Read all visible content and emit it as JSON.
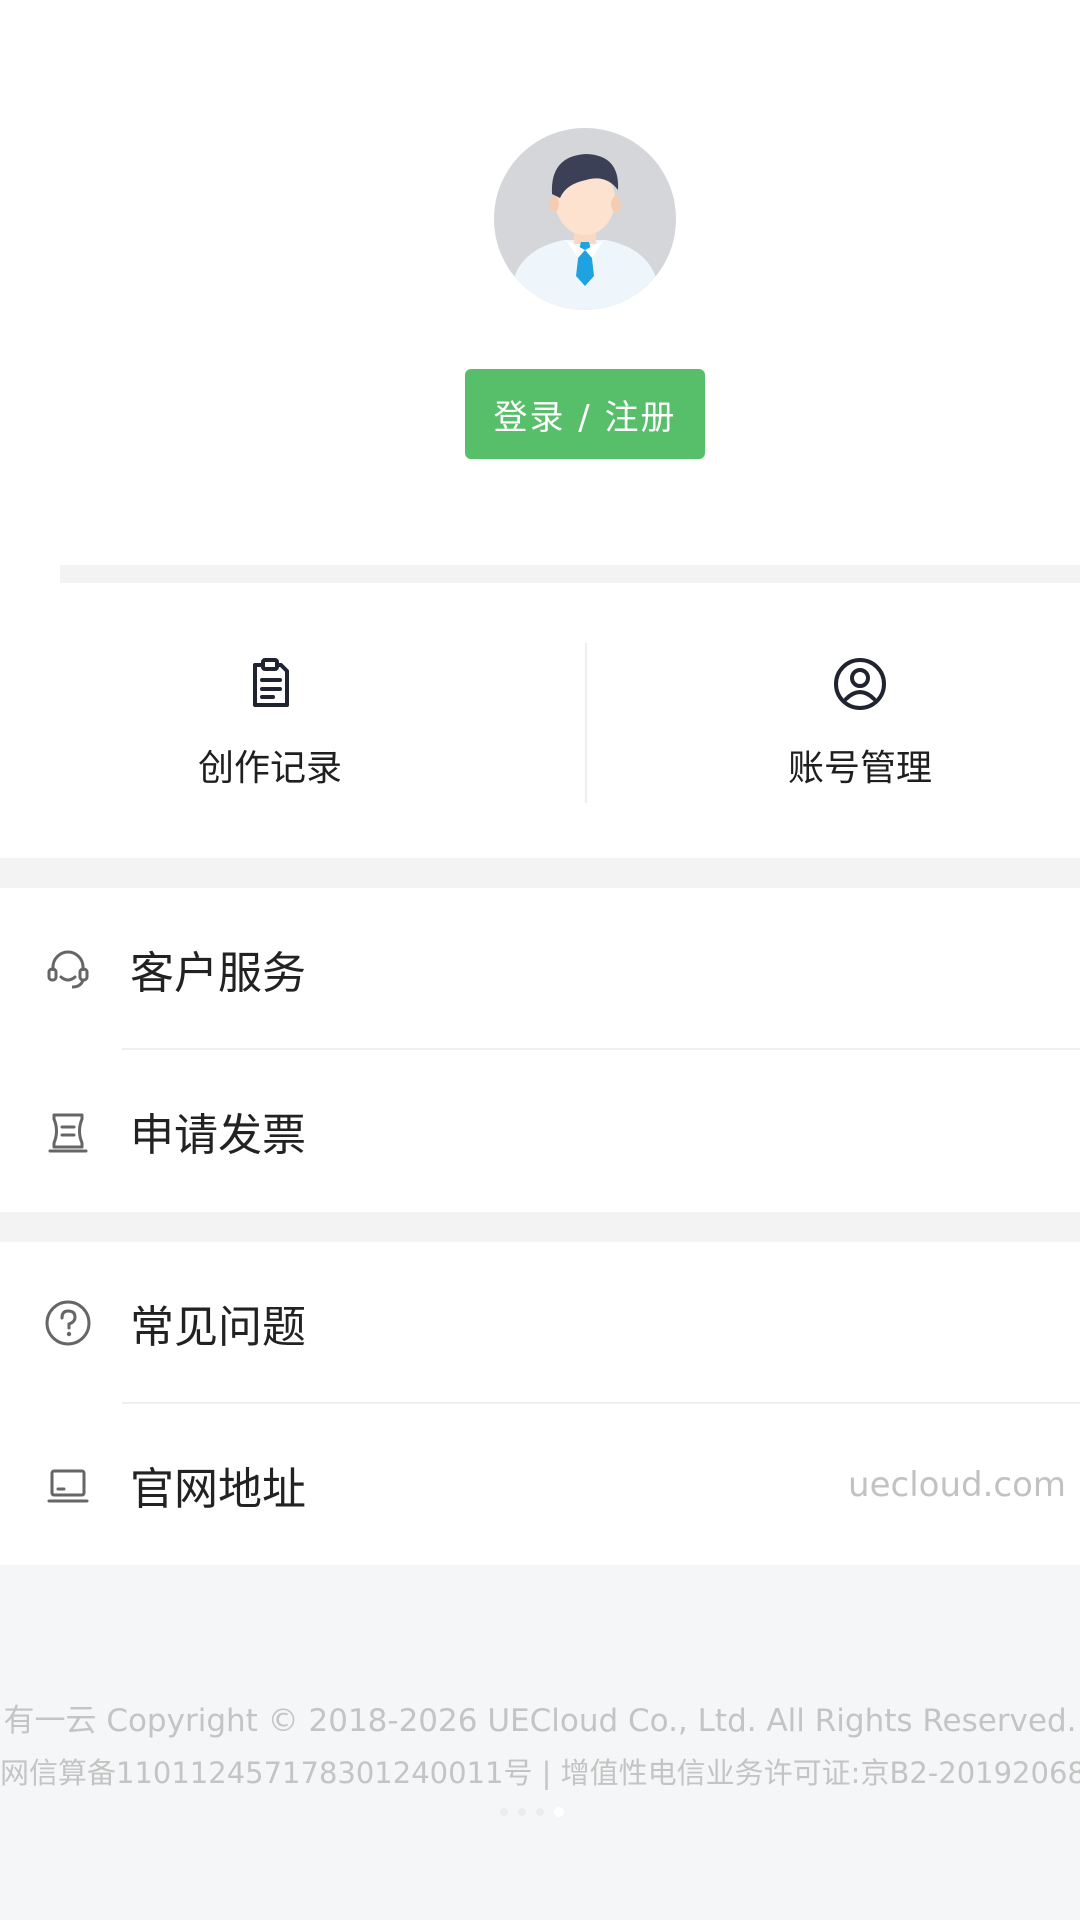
{
  "profile": {
    "avatar_label": "avatar",
    "login_button": "登录 / 注册"
  },
  "quick_actions": [
    {
      "label": "创作记录",
      "icon": "clipboard-icon"
    },
    {
      "label": "账号管理",
      "icon": "user-circle-icon"
    }
  ],
  "menu": {
    "group1": [
      {
        "label": "客户服务",
        "icon": "headset-icon"
      },
      {
        "label": "申请发票",
        "icon": "invoice-icon"
      }
    ],
    "group2": [
      {
        "label": "常见问题",
        "icon": "question-circle-icon"
      },
      {
        "label": "官网地址",
        "icon": "laptop-icon",
        "value": "uecloud.com"
      }
    ]
  },
  "footer": {
    "line1": "有一云 Copyright © 2018-2026 UECloud Co., Ltd. All Rights Reserved.",
    "line2": "网信算备110112457178301240011号 | 增值性电信业务许可证:京B2-20192068"
  },
  "colors": {
    "accent_green": "#57be6a",
    "page_gray": "#f3f3f3",
    "text_dark": "#222222",
    "text_muted": "#c2c2c2"
  }
}
